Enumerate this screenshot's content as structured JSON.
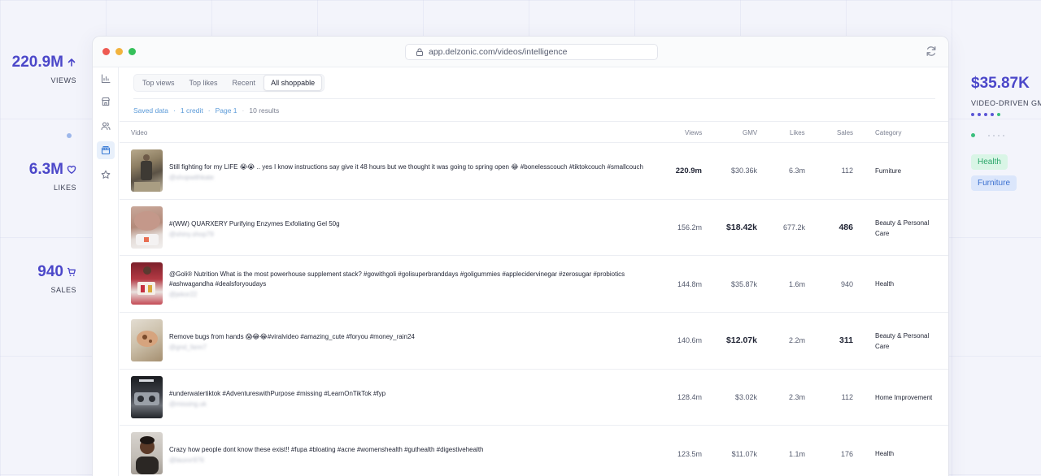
{
  "left_stats": {
    "views": {
      "value": "220.9M",
      "label": "VIEWS"
    },
    "likes": {
      "value": "6.3M",
      "label": "LIKES"
    },
    "sales": {
      "value": "940",
      "label": "SALES"
    }
  },
  "right_stats": {
    "gmv": {
      "value": "$35.87K",
      "label": "VIDEO-DRIVEN GMV"
    },
    "tags": [
      "Health",
      "Furniture"
    ]
  },
  "browser": {
    "url": "app.delzonic.com/videos/intelligence"
  },
  "tabs": [
    {
      "label": "Top views",
      "active": false
    },
    {
      "label": "Top likes",
      "active": false
    },
    {
      "label": "Recent",
      "active": false
    },
    {
      "label": "All shoppable",
      "active": true
    }
  ],
  "meta": {
    "saved": "Saved data",
    "credit": "1 credit",
    "page": "Page 1",
    "results": "10 results"
  },
  "table": {
    "headers": {
      "video": "Video",
      "views": "Views",
      "gmv": "GMV",
      "likes": "Likes",
      "sales": "Sales",
      "category": "Category"
    },
    "rows": [
      {
        "title": "Still fighting for my LIFE 😭😭 .. yes I know instructions say give it 48 hours but we thought it was going to spring open 😂 #bonelesscouch #tiktokcouch #smallcouch",
        "handle": "@shopwithkate",
        "views": "220.9m",
        "gmv": "$30.36k",
        "likes": "6.3m",
        "sales": "112",
        "category": [
          "Furniture"
        ]
      },
      {
        "title": "#(WW) QUARXERY Purifying Enzymes Exfoliating Gel 50g",
        "handle": "@shiny.shop79",
        "views": "156.2m",
        "gmv": "$18.42k",
        "likes": "677.2k",
        "sales": "486",
        "category": [
          "Beauty & Personal",
          "Care"
        ]
      },
      {
        "title": "@Goli® Nutrition What is the most powerhouse supplement stack? #gowithgoli #golisuperbranddays #goligummies #applecidervinegar #zerosugar #probiotics #ashwagandha #dealsforyoudays",
        "handle": "@jekor22",
        "views": "144.8m",
        "gmv": "$35.87k",
        "likes": "1.6m",
        "sales": "940",
        "category": [
          "Health"
        ]
      },
      {
        "title": "Remove bugs from hands 😱😂😂#viralvideo #amazing_cute #foryou #money_rain24",
        "handle": "@gnd_fann7",
        "views": "140.6m",
        "gmv": "$12.07k",
        "likes": "2.2m",
        "sales": "311",
        "category": [
          "Beauty & Personal",
          "Care"
        ]
      },
      {
        "title": "#underwatertiktok #AdventureswithPurpose #missing #LearnOnTikTok #fyp",
        "handle": "@missing.uk",
        "views": "128.4m",
        "gmv": "$3.02k",
        "likes": "2.3m",
        "sales": "112",
        "category": [
          "Home Improvement"
        ]
      },
      {
        "title": "Crazy how people dont know these exist!! #fupa #bloating #acne #womenshealth #guthealth #digestivehealth",
        "handle": "@lauvvr976",
        "views": "123.5m",
        "gmv": "$11.07k",
        "likes": "1.1m",
        "sales": "176",
        "category": [
          "Health"
        ]
      }
    ]
  },
  "colors": {
    "accent": "#4b47c9",
    "link": "#5b9ad8",
    "health_tag_bg": "#d9f5e6",
    "health_tag_fg": "#2aa66a",
    "furniture_tag_bg": "#dbe6fb",
    "furniture_tag_fg": "#3a6fd0"
  }
}
